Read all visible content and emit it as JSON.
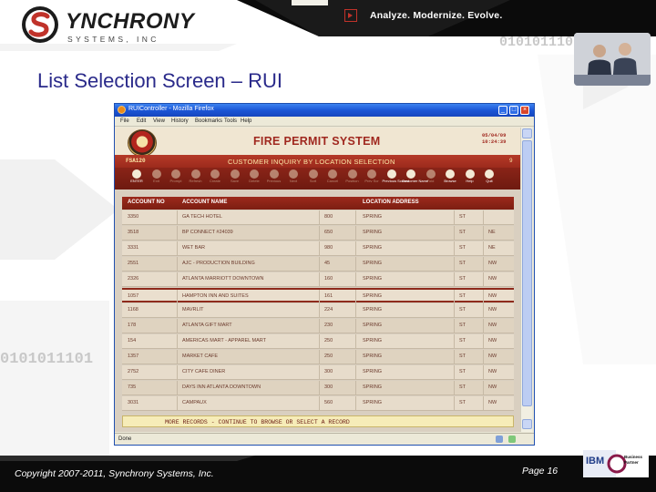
{
  "slide": {
    "logo_name": "YNCHRONY",
    "logo_sub": "SYSTEMS, INC",
    "tagline": "Analyze. Modernize. Evolve.",
    "binary_top": "0101011101",
    "binary_left": "0101011101",
    "title": "List Selection Screen – RUI",
    "copyright": "Copyright 2007-2011, Synchrony Systems, Inc.",
    "page": "Page 16",
    "ibm_logo": "IBM",
    "business_partner": "Business Partner"
  },
  "browser": {
    "window_title": "RUIController - Mozilla Firefox",
    "menu": [
      "File",
      "Edit",
      "View",
      "History",
      "Bookmarks",
      "Tools",
      "Help"
    ],
    "status": "Done",
    "buttons": [
      "minimize",
      "maximize",
      "close"
    ]
  },
  "app": {
    "system_title": "FIRE PERMIT SYSTEM",
    "date": "05/04/09",
    "time": "10:24:39",
    "screen_id": "FSA120",
    "subtitle": "CUSTOMER INQUIRY BY LOCATION SELECTION",
    "page_num": "9",
    "toolbar": [
      {
        "label": "ENTER",
        "active": true
      },
      {
        "label": "Exit",
        "active": false
      },
      {
        "label": "Prompt",
        "active": false
      },
      {
        "label": "Refresh",
        "active": false
      },
      {
        "label": "Create",
        "active": false
      },
      {
        "label": "Save",
        "active": false
      },
      {
        "label": "Delete",
        "active": false
      },
      {
        "label": "Previous",
        "active": false
      },
      {
        "label": "Next",
        "active": false
      },
      {
        "label": "Sort",
        "active": false
      },
      {
        "label": "Cancel",
        "active": false
      },
      {
        "label": "Position",
        "active": false
      },
      {
        "label": "Prev Scr",
        "active": false
      },
      {
        "label": "Previous Screen",
        "active": true
      },
      {
        "label": "Customer Name",
        "active": true
      },
      {
        "label": "Fold",
        "active": false
      },
      {
        "label": "Browse",
        "active": true
      },
      {
        "label": "Help",
        "active": true
      },
      {
        "label": "Quit",
        "active": true
      }
    ],
    "columns": [
      "ACCOUNT NO",
      "ACCOUNT NAME",
      "LOCATION ADDRESS"
    ],
    "rows": [
      {
        "acct": "3350",
        "name": "GA TECH HOTEL",
        "num": "800",
        "street": "SPRING",
        "type": "ST",
        "dir": ""
      },
      {
        "acct": "3518",
        "name": "BP CONNECT #24039",
        "num": "650",
        "street": "SPRING",
        "type": "ST",
        "dir": "NE"
      },
      {
        "acct": "3331",
        "name": "WET BAR",
        "num": "980",
        "street": "SPRING",
        "type": "ST",
        "dir": "NE"
      },
      {
        "acct": "2551",
        "name": "AJC - PRODUCTION BUILDING",
        "num": "45",
        "street": "SPRING",
        "type": "ST",
        "dir": "NW"
      },
      {
        "acct": "2326",
        "name": "ATLANTA MARRIOTT DOWNTOWN",
        "num": "160",
        "street": "SPRING",
        "type": "ST",
        "dir": "NW"
      },
      {
        "acct": "1057",
        "name": "HAMPTON INN AND SUITES",
        "num": "161",
        "street": "SPRING",
        "type": "ST",
        "dir": "NW"
      },
      {
        "acct": "1168",
        "name": "MAVRLIT",
        "num": "224",
        "street": "SPRING",
        "type": "ST",
        "dir": "NW"
      },
      {
        "acct": "178",
        "name": "ATLANTA GIFT MART",
        "num": "230",
        "street": "SPRING",
        "type": "ST",
        "dir": "NW"
      },
      {
        "acct": "154",
        "name": "AMERICAS MART - APPAREL MART",
        "num": "250",
        "street": "SPRING",
        "type": "ST",
        "dir": "NW"
      },
      {
        "acct": "1357",
        "name": "MARKET CAFE",
        "num": "250",
        "street": "SPRING",
        "type": "ST",
        "dir": "NW"
      },
      {
        "acct": "2752",
        "name": "CITY CAFE DINER",
        "num": "300",
        "street": "SPRING",
        "type": "ST",
        "dir": "NW"
      },
      {
        "acct": "735",
        "name": "DAYS INN ATLANTA DOWNTOWN",
        "num": "300",
        "street": "SPRING",
        "type": "ST",
        "dir": "NW"
      },
      {
        "acct": "3031",
        "name": "CAMPAUX",
        "num": "560",
        "street": "SPRING",
        "type": "ST",
        "dir": "NW"
      }
    ],
    "selected_row_index": 5,
    "message": "MORE RECORDS - CONTINUE TO BROWSE OR SELECT A RECORD"
  }
}
